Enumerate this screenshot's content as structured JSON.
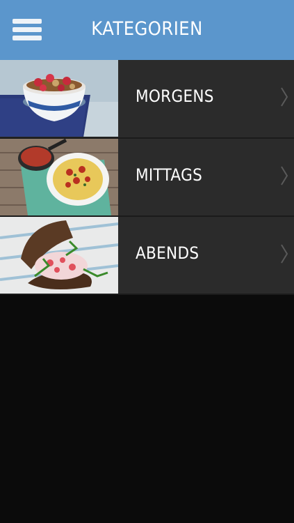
{
  "header": {
    "title": "KATEGORIEN",
    "menu_icon": "hamburger-menu-icon",
    "color": "#5b96cc"
  },
  "categories": [
    {
      "label": "MORGENS",
      "image": "breakfast-cereal-bowl",
      "icon": "chevron-right-icon"
    },
    {
      "label": "MITTAGS",
      "image": "spaghetti-plate",
      "icon": "chevron-right-icon"
    },
    {
      "label": "ABENDS",
      "image": "open-sandwich",
      "icon": "chevron-right-icon"
    }
  ],
  "colors": {
    "row_bg": "#2b2b2b",
    "page_bg": "#0b0b0b"
  }
}
